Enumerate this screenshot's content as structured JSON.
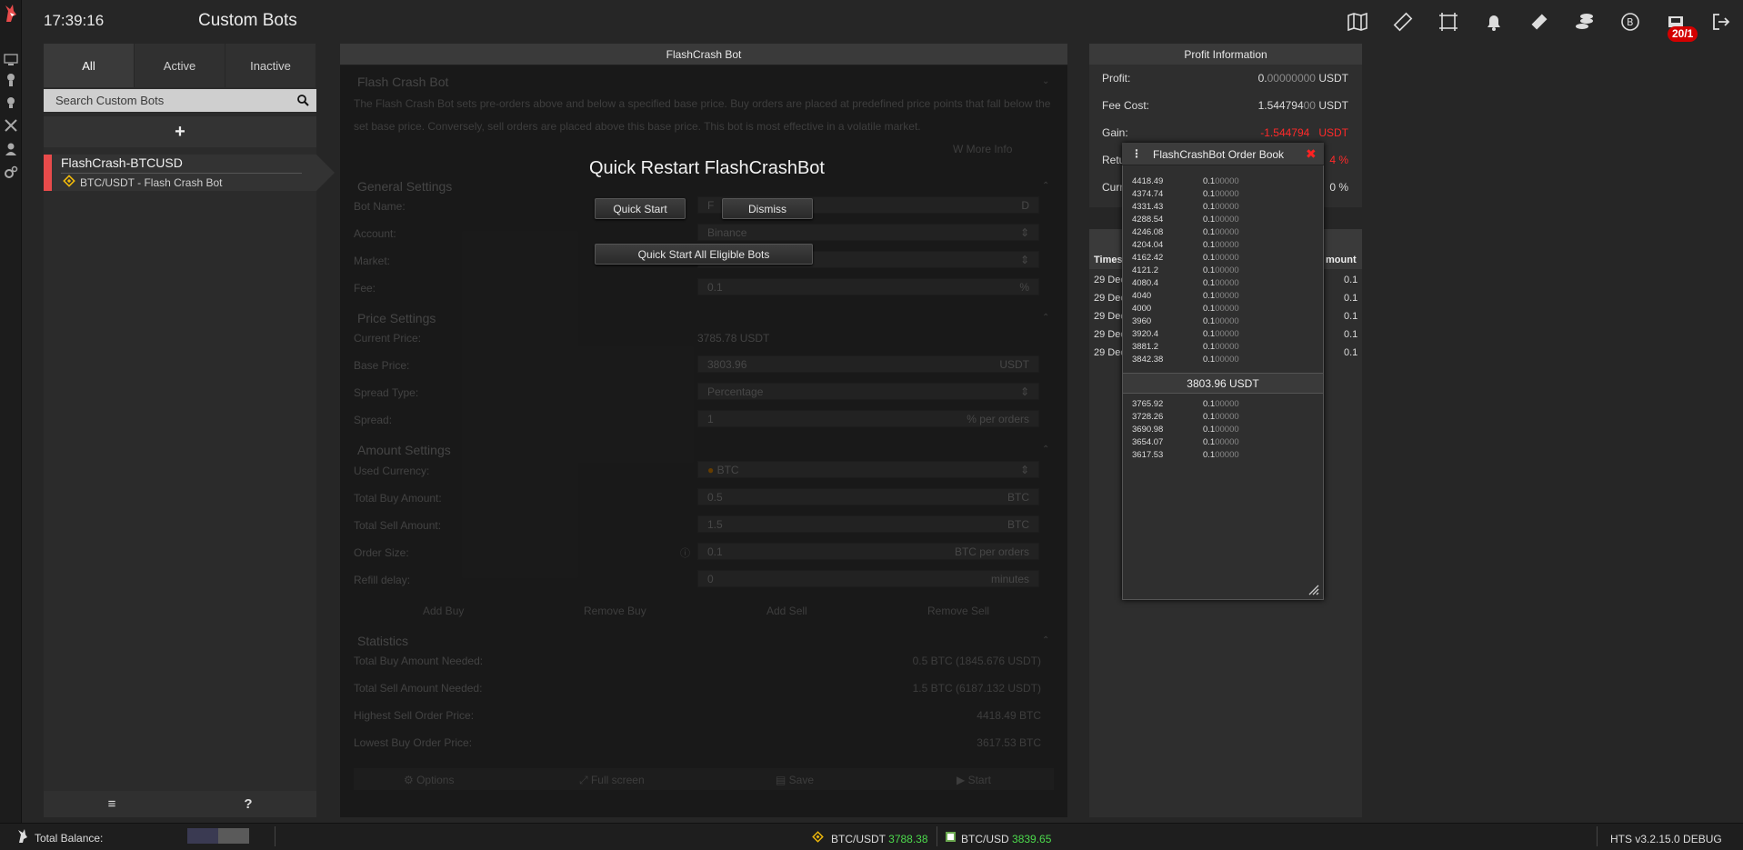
{
  "topbar": {
    "clock": "17:39:16",
    "title": "Custom Bots",
    "notification_badge": "20/1"
  },
  "bots_panel": {
    "tabs": [
      "All",
      "Active",
      "Inactive"
    ],
    "search_placeholder": "Search Custom Bots",
    "add_label": "+",
    "bot": {
      "name": "FlashCrash-BTCUSD",
      "subtitle": "BTC/USDT - Flash Crash Bot"
    },
    "footer": {
      "menu_label": "≡",
      "help_label": "?"
    }
  },
  "center": {
    "header": "FlashCrash Bot",
    "intro_title": "Flash Crash Bot",
    "intro_text": "The Flash Crash Bot sets pre-orders above and below a specified base price. Buy orders are placed at predefined price points that fall below the set base price. Conversely, sell orders are placed above this base price. This bot is most effective in a volatile market.",
    "more_info": "More Info",
    "general": {
      "title": "General Settings",
      "bot_name_label": "Bot Name:",
      "bot_name_value": "F",
      "bot_name_tail": "D",
      "account_label": "Account:",
      "account_value": "Binance",
      "market_label": "Market:",
      "fee_label": "Fee:",
      "fee_value": "0.1",
      "fee_unit": "%"
    },
    "price": {
      "title": "Price Settings",
      "current_label": "Current Price:",
      "current_value": "3785.78 USDT",
      "base_label": "Base Price:",
      "base_value": "3803.96",
      "base_unit": "USDT",
      "spread_type_label": "Spread Type:",
      "spread_type_value": "Percentage",
      "spread_label": "Spread:",
      "spread_value": "1",
      "spread_unit": "% per orders"
    },
    "amount": {
      "title": "Amount Settings",
      "currency_label": "Used Currency:",
      "currency_value": "BTC",
      "buy_label": "Total Buy Amount:",
      "buy_value": "0.5",
      "buy_unit": "BTC",
      "sell_label": "Total Sell Amount:",
      "sell_value": "1.5",
      "sell_unit": "BTC",
      "order_label": "Order Size:",
      "order_value": "0.1",
      "order_unit": "BTC per orders",
      "refill_label": "Refill delay:",
      "refill_value": "0",
      "refill_unit": "minutes",
      "buttons": [
        "Add Buy",
        "Remove Buy",
        "Add Sell",
        "Remove Sell"
      ]
    },
    "statistics": {
      "title": "Statistics",
      "rows": [
        {
          "label": "Total Buy Amount Needed:",
          "value": "0.5 BTC (1845.676 USDT)"
        },
        {
          "label": "Total Sell Amount Needed:",
          "value": "1.5 BTC (6187.132 USDT)"
        },
        {
          "label": "Highest Sell Order Price:",
          "value": "4418.49 BTC"
        },
        {
          "label": "Lowest Buy Order Price:",
          "value": "3617.53 BTC"
        }
      ]
    },
    "bottom_buttons": [
      "Options",
      "Full screen",
      "Save",
      "Start"
    ]
  },
  "quick_restart": {
    "title": "Quick Restart FlashCrashBot",
    "quick_start": "Quick Start",
    "dismiss": "Dismiss",
    "quick_start_all": "Quick Start All Eligible Bots"
  },
  "profit": {
    "header": "Profit Information",
    "profit_label": "Profit:",
    "profit_value_main": "0.",
    "profit_value_dim": "00000000",
    "profit_unit": "USDT",
    "fee_label": "Fee Cost:",
    "fee_value_main": "1.544794",
    "fee_value_dim": "00",
    "fee_unit": "USDT",
    "gain_label": "Gain:",
    "gain_value_main": "-1.544794",
    "gain_unit": "USDT",
    "return_label": "Retu",
    "return_value": "4 %",
    "current_label": "Curr",
    "current_value": "0 %"
  },
  "trades": {
    "col_time": "Timest",
    "col_amount": "mount",
    "rows": [
      {
        "time": "29 Dec",
        "amount": "0.1"
      },
      {
        "time": "29 Dec",
        "amount": "0.1"
      },
      {
        "time": "29 Dec",
        "amount": "0.1"
      },
      {
        "time": "29 Dec",
        "amount": "0.1"
      },
      {
        "time": "29 Dec",
        "amount": "0.1"
      }
    ]
  },
  "order_book": {
    "title": "FlashCrashBot Order Book",
    "menu": "⋮",
    "close": "✖",
    "sells": [
      {
        "price": "4418.49",
        "amt": "0.1",
        "dim": "00000"
      },
      {
        "price": "4374.74",
        "amt": "0.1",
        "dim": "00000"
      },
      {
        "price": "4331.43",
        "amt": "0.1",
        "dim": "00000"
      },
      {
        "price": "4288.54",
        "amt": "0.1",
        "dim": "00000"
      },
      {
        "price": "4246.08",
        "amt": "0.1",
        "dim": "00000"
      },
      {
        "price": "4204.04",
        "amt": "0.1",
        "dim": "00000"
      },
      {
        "price": "4162.42",
        "amt": "0.1",
        "dim": "00000"
      },
      {
        "price": "4121.2",
        "amt": "0.1",
        "dim": "00000"
      },
      {
        "price": "4080.4",
        "amt": "0.1",
        "dim": "00000"
      },
      {
        "price": "4040",
        "amt": "0.1",
        "dim": "00000"
      },
      {
        "price": "4000",
        "amt": "0.1",
        "dim": "00000"
      },
      {
        "price": "3960",
        "amt": "0.1",
        "dim": "00000"
      },
      {
        "price": "3920.4",
        "amt": "0.1",
        "dim": "00000"
      },
      {
        "price": "3881.2",
        "amt": "0.1",
        "dim": "00000"
      },
      {
        "price": "3842.38",
        "amt": "0.1",
        "dim": "00000"
      }
    ],
    "mid": "3803.96 USDT",
    "buys": [
      {
        "price": "3765.92",
        "amt": "0.1",
        "dim": "00000"
      },
      {
        "price": "3728.26",
        "amt": "0.1",
        "dim": "00000"
      },
      {
        "price": "3690.98",
        "amt": "0.1",
        "dim": "00000"
      },
      {
        "price": "3654.07",
        "amt": "0.1",
        "dim": "00000"
      },
      {
        "price": "3617.53",
        "amt": "0.1",
        "dim": "00000"
      }
    ]
  },
  "statusbar": {
    "total_balance_label": "Total Balance:",
    "ticker1_pair": "BTC/USDT",
    "ticker1_price": "3788.38",
    "ticker2_pair": "BTC/USD",
    "ticker2_price": "3839.65",
    "version": "HTS v3.2.15.0 DEBUG"
  }
}
